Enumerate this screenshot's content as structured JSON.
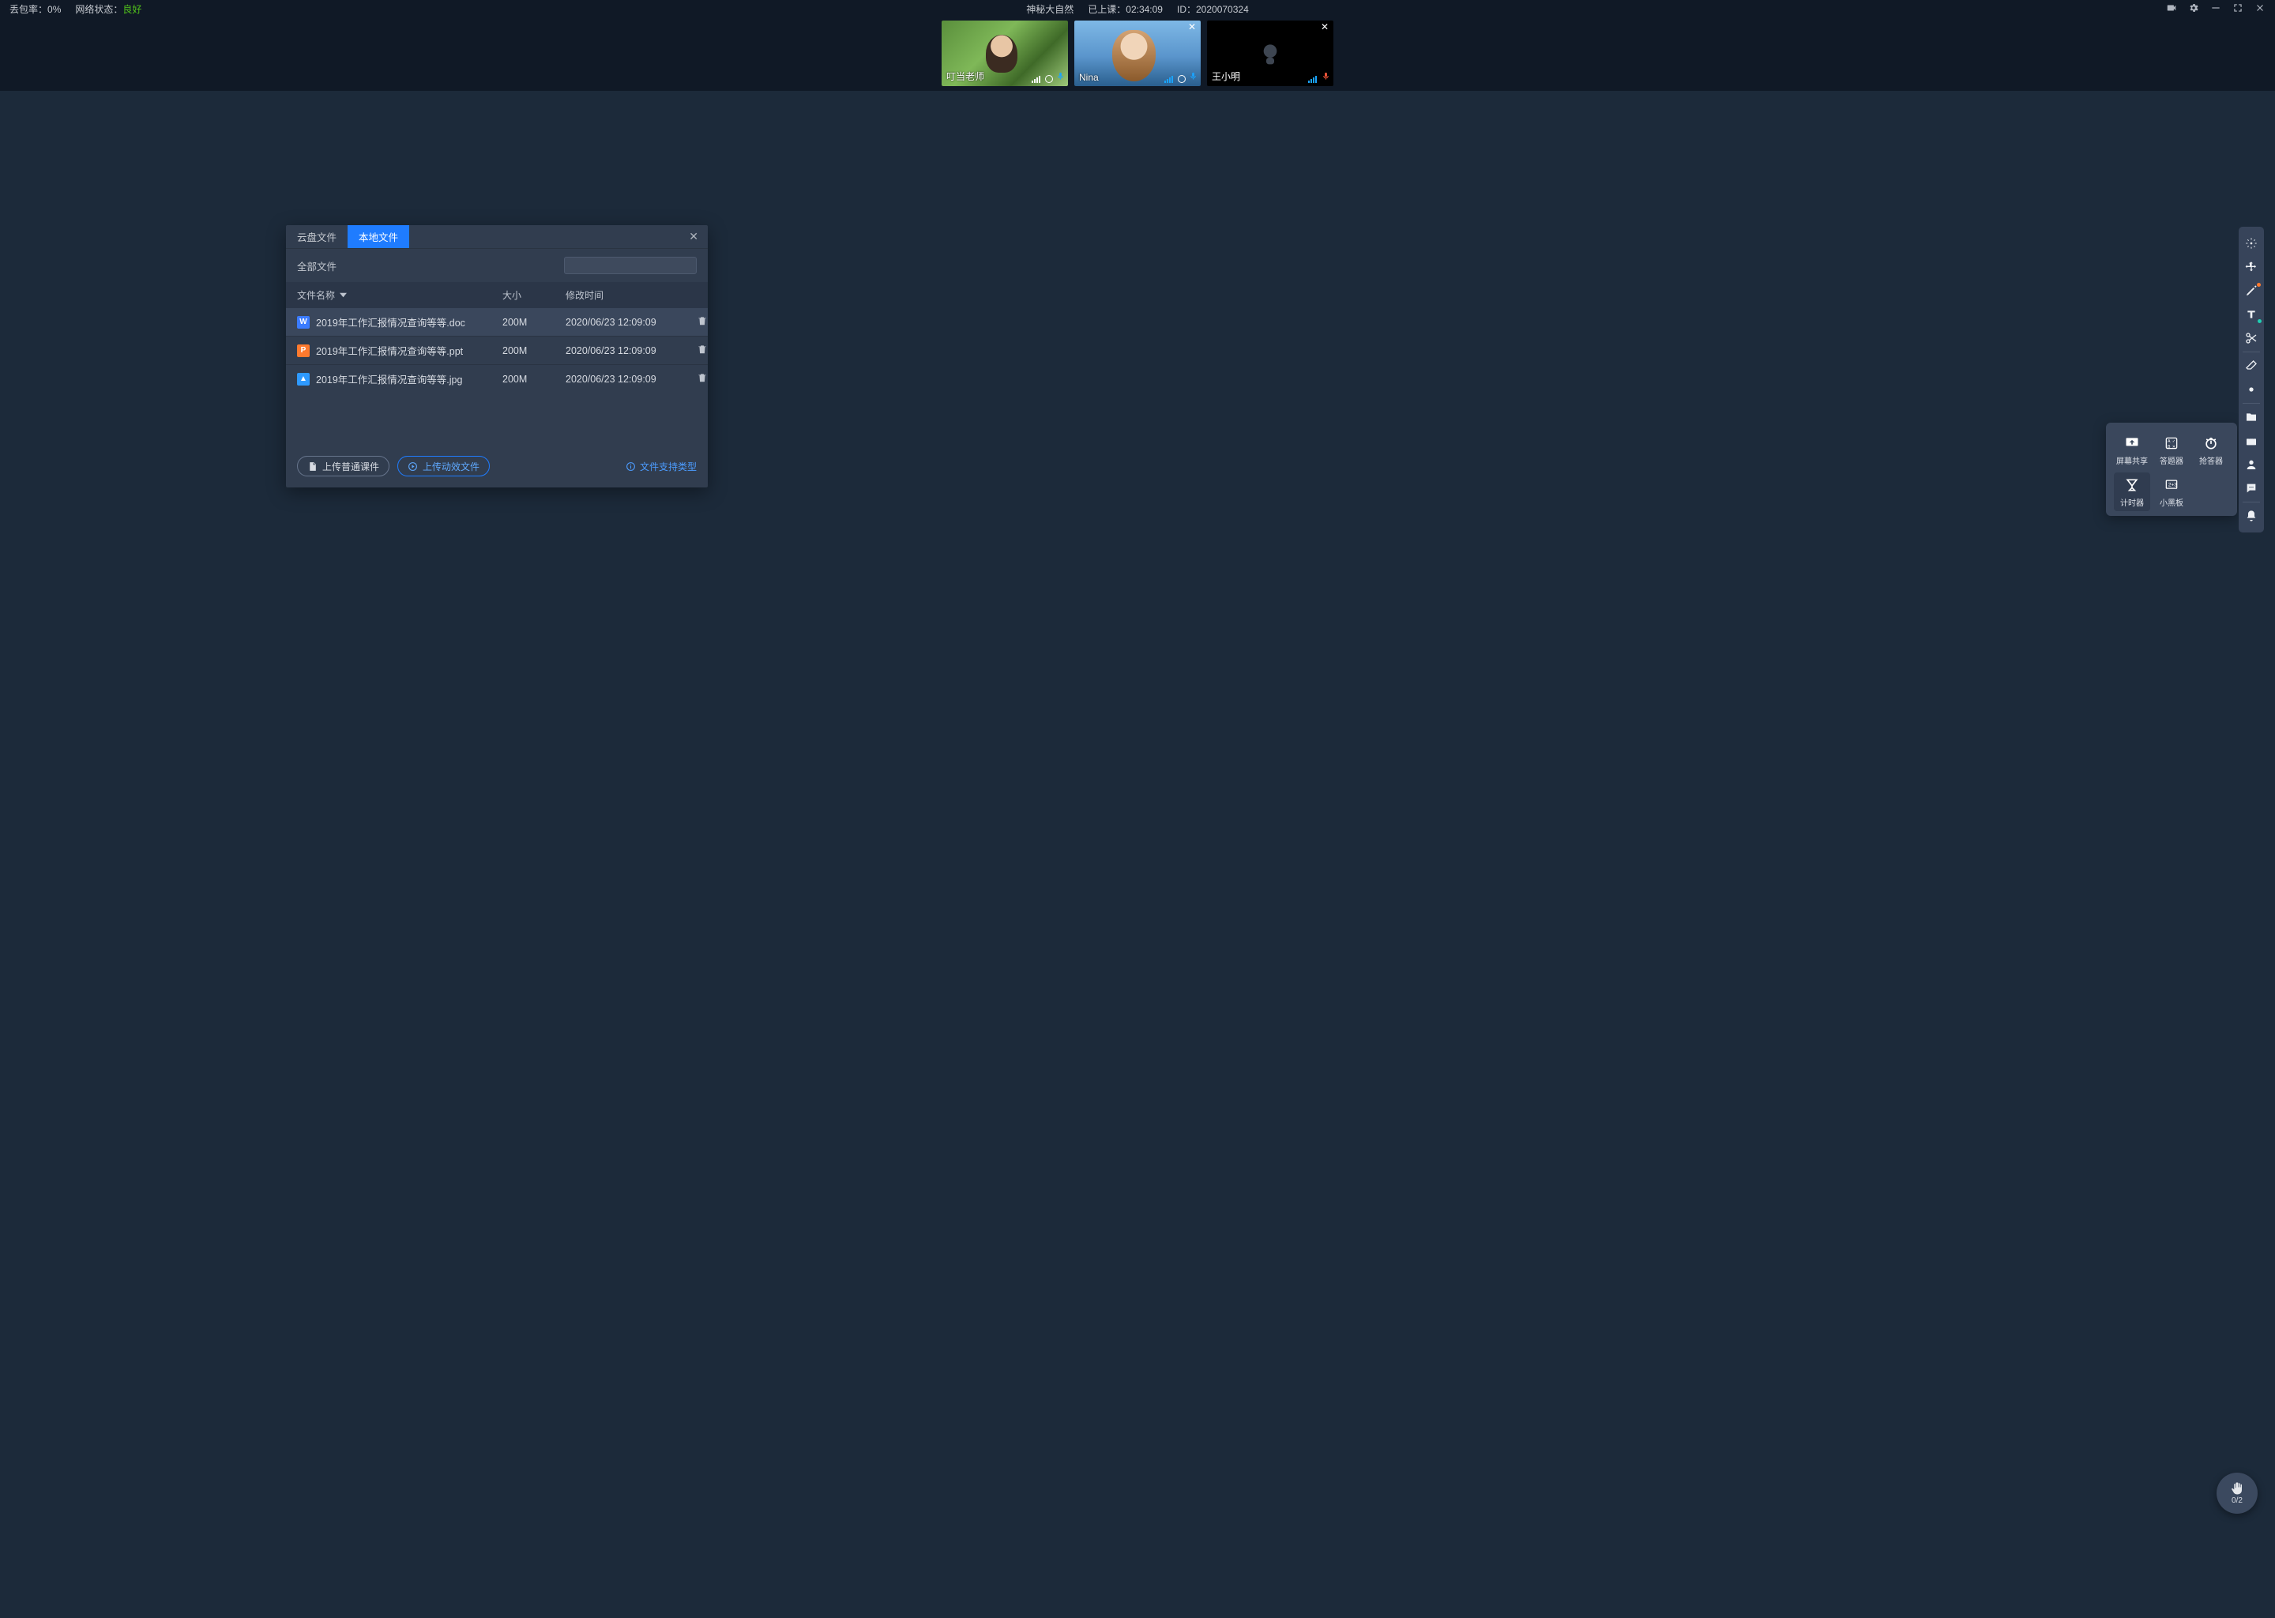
{
  "status": {
    "packet_loss_label": "丢包率：",
    "packet_loss_value": "0%",
    "net_label": "网络状态：",
    "net_value": "良好",
    "title": "神秘大自然",
    "class_label": "已上课：",
    "class_time": "02:34:09",
    "id_label": "ID：",
    "id_value": "2020070324"
  },
  "videos": [
    {
      "name": "叮当老师",
      "camera_off": false,
      "mic": "on",
      "closable": false
    },
    {
      "name": "Nina",
      "camera_off": false,
      "mic": "on",
      "closable": true
    },
    {
      "name": "王小明",
      "camera_off": true,
      "mic": "off",
      "closable": true
    }
  ],
  "dialog": {
    "tabs": {
      "cloud": "云盘文件",
      "local": "本地文件",
      "active": "local"
    },
    "all_files": "全部文件",
    "columns": {
      "name": "文件名称",
      "size": "大小",
      "mtime": "修改时间"
    },
    "rows": [
      {
        "icon": "doc",
        "glyph": "W",
        "name": "2019年工作汇报情况查询等等.doc",
        "size": "200M",
        "mtime": "2020/06/23 12:09:09",
        "hl": true
      },
      {
        "icon": "ppt",
        "glyph": "P",
        "name": "2019年工作汇报情况查询等等.ppt",
        "size": "200M",
        "mtime": "2020/06/23 12:09:09",
        "hl": false
      },
      {
        "icon": "jpg",
        "glyph": "▲",
        "name": "2019年工作汇报情况查询等等.jpg",
        "size": "200M",
        "mtime": "2020/06/23 12:09:09",
        "hl": false
      }
    ],
    "upload_normal": "上传普通课件",
    "upload_fx": "上传动效文件",
    "support": "文件支持类型"
  },
  "toolbox": {
    "items": [
      {
        "key": "screen_share",
        "label": "屏幕共享"
      },
      {
        "key": "answer",
        "label": "答题器"
      },
      {
        "key": "responder",
        "label": "抢答器"
      },
      {
        "key": "timer",
        "label": "计时器",
        "selected": true
      },
      {
        "key": "blackboard",
        "label": "小黑板"
      }
    ]
  },
  "vtoolbar": [
    "laser",
    "move",
    "pen",
    "text",
    "scissors",
    "-",
    "eraser",
    "dot",
    "-",
    "folder",
    "toolbox",
    "user",
    "chat",
    "-",
    "bell"
  ],
  "hand": {
    "count": "0/2"
  }
}
